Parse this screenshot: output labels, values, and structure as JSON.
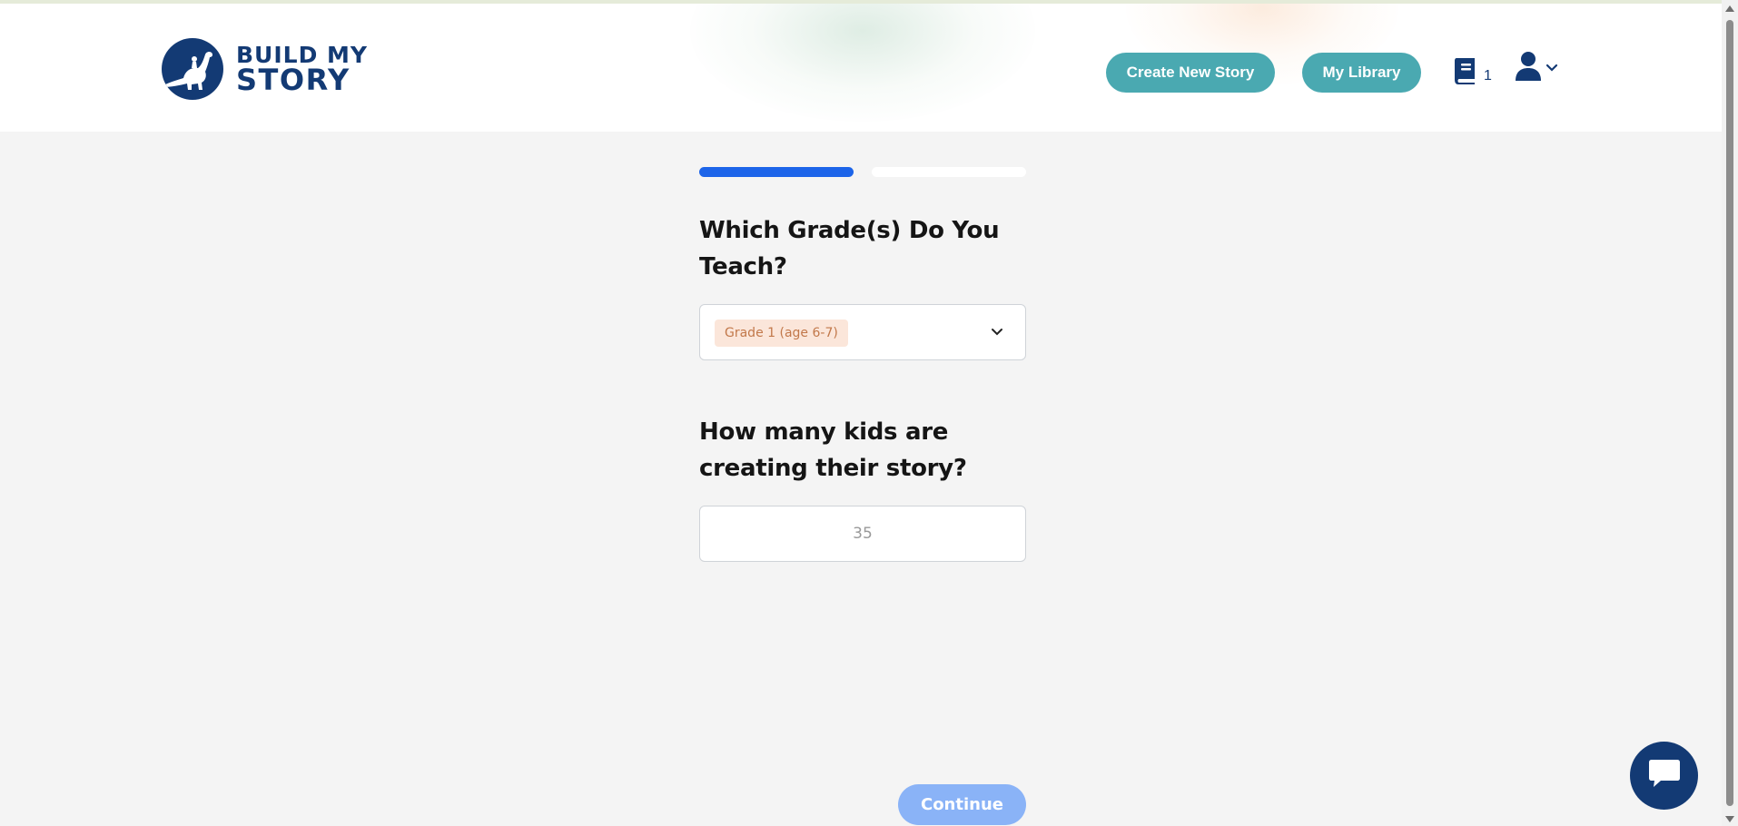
{
  "brand": {
    "line1": "BUILD MY",
    "line2": "STORY",
    "color": "#133a74"
  },
  "nav": {
    "create_label": "Create New Story",
    "library_label": "My Library",
    "library_count": "1",
    "button_color": "#4aa9b1",
    "icons": {
      "library": "book-icon",
      "user": "user-icon",
      "menu": "chevron-down-icon"
    }
  },
  "steps": {
    "total": 2,
    "current": 1,
    "active_color": "#1c64e9"
  },
  "grade": {
    "question": "Which Grade(s) Do You Teach?",
    "selected": "Grade 1 (age 6-7)"
  },
  "kids": {
    "question": "How many kids are creating their story?",
    "placeholder": "35"
  },
  "footer": {
    "continue_label": "Continue",
    "continue_color": "#8ab3f7",
    "chat_icon": "chat-bubble-icon"
  }
}
